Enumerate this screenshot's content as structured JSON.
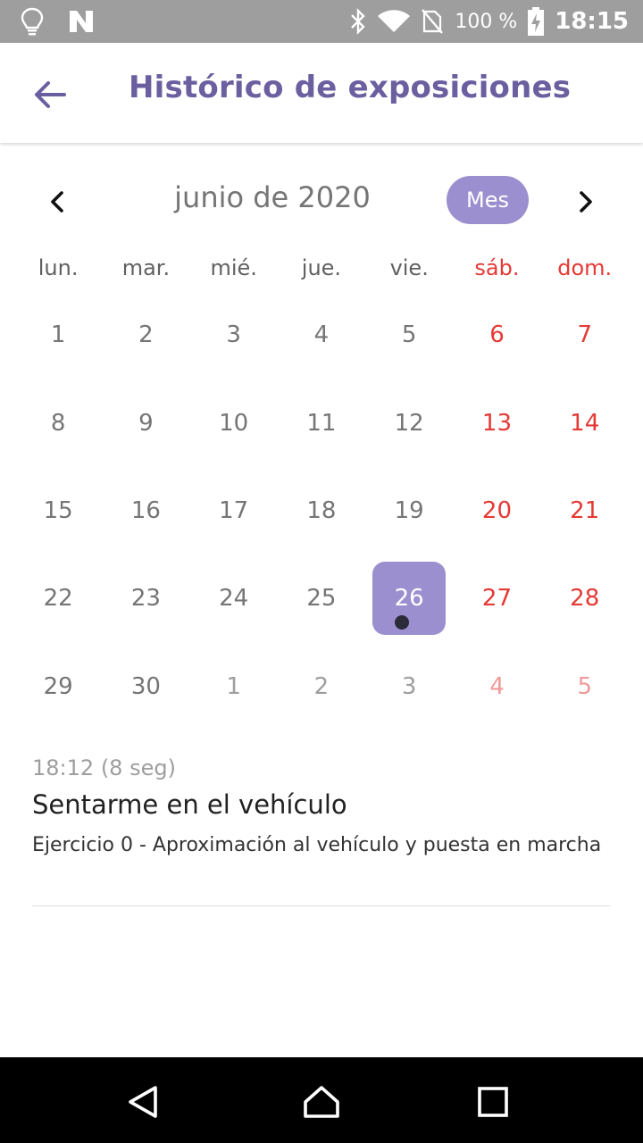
{
  "status_bar": {
    "battery_text": "100 %",
    "time": "18:15",
    "icons": [
      "lightbulb-icon",
      "n-logo-icon",
      "bluetooth-icon",
      "wifi-icon",
      "no-sim-icon",
      "battery-charging-icon"
    ]
  },
  "app_bar": {
    "title": "Histórico de exposiciones",
    "back_icon": "arrow-back-icon"
  },
  "calendar": {
    "month_label": "junio de 2020",
    "view_button": "Mes",
    "weekdays": [
      "lun.",
      "mar.",
      "mié.",
      "jue.",
      "vie.",
      "sáb.",
      "dom."
    ],
    "weeks": [
      [
        "1",
        "2",
        "3",
        "4",
        "5",
        "6",
        "7"
      ],
      [
        "8",
        "9",
        "10",
        "11",
        "12",
        "13",
        "14"
      ],
      [
        "15",
        "16",
        "17",
        "18",
        "19",
        "20",
        "21"
      ],
      [
        "22",
        "23",
        "24",
        "25",
        "26",
        "27",
        "28"
      ],
      [
        "29",
        "30",
        "1",
        "2",
        "3",
        "4",
        "5"
      ]
    ],
    "selected_day": "26",
    "weekend_color": "#e53935",
    "accent_color": "#9b8fd0"
  },
  "entries": [
    {
      "time": "18:12",
      "duration": "(8 seg)",
      "title": "Sentarme en el vehículo",
      "description": "Ejercicio 0 - Aproximación al vehículo y puesta en marcha"
    }
  ],
  "nav_bar": {
    "icons": [
      "back-triangle-icon",
      "home-icon",
      "recents-square-icon"
    ]
  }
}
